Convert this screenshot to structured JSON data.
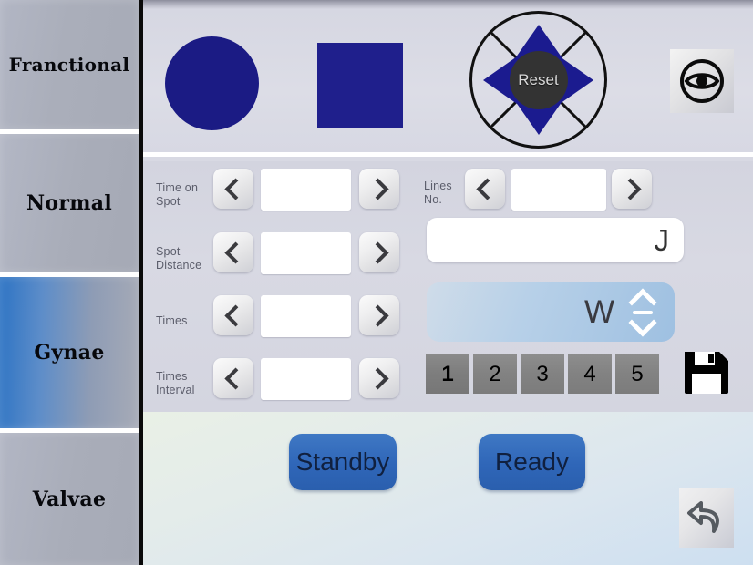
{
  "sidebar": {
    "items": [
      {
        "label": "Franctional",
        "selected": false
      },
      {
        "label": "Normal",
        "selected": false
      },
      {
        "label": "Gynae",
        "selected": true
      },
      {
        "label": "Valvae",
        "selected": false
      }
    ]
  },
  "top_panel": {
    "shape_circle": "circle-shape",
    "shape_square": "square-shape",
    "dpad": {
      "center_label": "Reset",
      "up": "up-arrow",
      "down": "down-arrow",
      "left": "left-arrow",
      "right": "right-arrow"
    },
    "eye_button": "eye-icon"
  },
  "form": {
    "left_fields": [
      {
        "label": "Time on\nSpot",
        "label_line1": "Time on",
        "label_line2": "Spot",
        "value": ""
      },
      {
        "label": "Spot\nDistance",
        "label_line1": "Spot",
        "label_line2": "Distance",
        "value": ""
      },
      {
        "label": "Times",
        "label_line1": "Times",
        "label_line2": "",
        "value": ""
      },
      {
        "label": "Times\nInterval",
        "label_line1": "Times",
        "label_line2": "Interval",
        "value": ""
      }
    ],
    "right_field": {
      "label_line1": "Lines",
      "label_line2": "No.",
      "value": ""
    },
    "energy": {
      "unit": "J",
      "value": ""
    },
    "power": {
      "unit": "W",
      "value": ""
    },
    "presets": [
      "1",
      "2",
      "3",
      "4",
      "5"
    ],
    "selected_preset": "1",
    "save_button": "save-disk-icon",
    "prev_arrow": "chevron-left-icon",
    "next_arrow": "chevron-right-icon",
    "spin_up": "chevron-up-icon",
    "spin_down": "chevron-down-icon"
  },
  "bottom_panel": {
    "standby_label": "Standby",
    "ready_label": "Ready",
    "back_button": "undo-arrow-icon"
  },
  "colors": {
    "shape_blue": "#1b1b8c",
    "accent_blue": "#2f66b8",
    "selected_tab_blue": "#2e74c4",
    "panel_bg": "#d8d9e3",
    "num_btn_gray": "#828282",
    "watt_field_blue": "#a9c7e4"
  }
}
